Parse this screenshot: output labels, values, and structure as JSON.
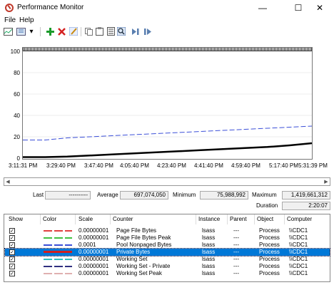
{
  "window": {
    "title": "Performance Monitor"
  },
  "menu": [
    "File",
    "Help"
  ],
  "toolbar": {
    "icons": [
      "view-graph-icon",
      "freeze-icon",
      "dropdown-icon",
      "add-counter-icon",
      "delete-counter-icon",
      "highlight-icon",
      "copy-icon",
      "paste-icon",
      "properties-icon",
      "zoom-icon",
      "update-icon",
      "stop-icon"
    ]
  },
  "graph": {
    "y_ticks": [
      "100",
      "80",
      "60",
      "40",
      "20",
      "0"
    ],
    "x_ticks": [
      "3:11:31 PM",
      "3:29:40 PM",
      "3:47:40 PM",
      "4:05:40 PM",
      "4:23:40 PM",
      "4:41:40 PM",
      "4:59:40 PM",
      "5:17:40 PM",
      "5:31:39 PM"
    ]
  },
  "chart_data": {
    "type": "line",
    "ylim": [
      0,
      100
    ],
    "series": [
      {
        "name": "Pool Nonpaged Bytes",
        "color": "#3b4fd8",
        "values": [
          17,
          17,
          19,
          20,
          21,
          22,
          23,
          24,
          25,
          26,
          27,
          28,
          29,
          30
        ]
      },
      {
        "name": "Private Bytes",
        "color": "#000000",
        "values": [
          1,
          1,
          1.5,
          2.5,
          3.5,
          4.5,
          5.5,
          6.5,
          7.5,
          8.5,
          9.5,
          10.5,
          12,
          14
        ]
      }
    ]
  },
  "stats": {
    "last_label": "Last",
    "last_value": "----------",
    "average_label": "Average",
    "average_value": "697,074,050",
    "minimum_label": "Minimum",
    "minimum_value": "75,988,992",
    "maximum_label": "Maximum",
    "maximum_value": "1,419,661,312",
    "duration_label": "Duration",
    "duration_value": "2:20:07"
  },
  "list": {
    "headers": [
      "Show",
      "Color",
      "Scale",
      "Counter",
      "Instance",
      "Parent",
      "Object",
      "Computer"
    ],
    "rows": [
      {
        "color": "#e04040",
        "scale": "0.00000001",
        "counter": "Page File Bytes",
        "instance": "lsass",
        "parent": "---",
        "object": "Process",
        "computer": "\\\\CDC1",
        "selected": false
      },
      {
        "color": "#40c040",
        "scale": "0.00000001",
        "counter": "Page File Bytes Peak",
        "instance": "lsass",
        "parent": "---",
        "object": "Process",
        "computer": "\\\\CDC1",
        "selected": false
      },
      {
        "color": "#3b4fd8",
        "scale": "0.0001",
        "counter": "Pool Nonpaged Bytes",
        "instance": "lsass",
        "parent": "---",
        "object": "Process",
        "computer": "\\\\CDC1",
        "selected": false
      },
      {
        "color": "#d02020",
        "scale": "0.00000001",
        "counter": "Private Bytes",
        "instance": "lsass",
        "parent": "---",
        "object": "Process",
        "computer": "\\\\CDC1",
        "selected": true
      },
      {
        "color": "#30c0c0",
        "scale": "0.00000001",
        "counter": "Working Set",
        "instance": "lsass",
        "parent": "---",
        "object": "Process",
        "computer": "\\\\CDC1",
        "selected": false
      },
      {
        "color": "#303080",
        "scale": "0.00000001",
        "counter": "Working Set - Private",
        "instance": "lsass",
        "parent": "---",
        "object": "Process",
        "computer": "\\\\CDC1",
        "selected": false
      },
      {
        "color": "#e0b0b0",
        "scale": "0.00000001",
        "counter": "Working Set Peak",
        "instance": "lsass",
        "parent": "---",
        "object": "Process",
        "computer": "\\\\CDC1",
        "selected": false
      }
    ]
  }
}
